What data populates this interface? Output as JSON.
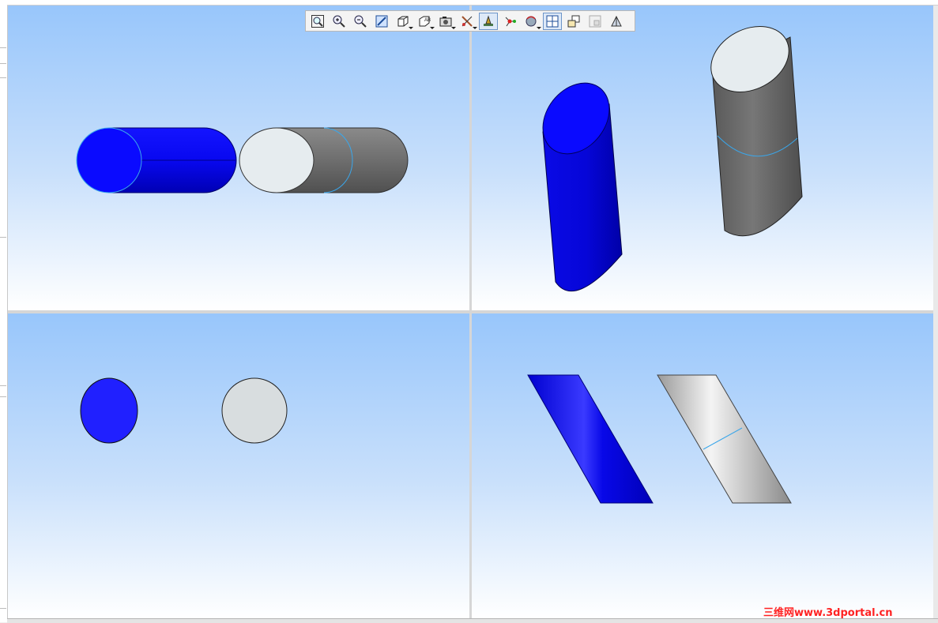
{
  "toolbar": {
    "buttons": [
      {
        "name": "zoom-to-fit",
        "tooltip": ""
      },
      {
        "name": "zoom-in",
        "tooltip": ""
      },
      {
        "name": "zoom-out",
        "tooltip": ""
      },
      {
        "name": "zoom-to-area",
        "tooltip": ""
      },
      {
        "name": "view-orientation",
        "tooltip": ""
      },
      {
        "name": "display-style",
        "tooltip": ""
      },
      {
        "name": "hide-show-items",
        "tooltip": ""
      },
      {
        "name": "appearance",
        "tooltip": ""
      },
      {
        "name": "scene-settings",
        "tooltip": ""
      },
      {
        "name": "view-settings",
        "tooltip": ""
      },
      {
        "name": "rotate-view",
        "tooltip": ""
      },
      {
        "name": "four-viewport",
        "tooltip": ""
      },
      {
        "name": "link-views",
        "tooltip": ""
      },
      {
        "name": "single-view",
        "tooltip": ""
      },
      {
        "name": "section-view",
        "tooltip": ""
      }
    ],
    "active_index": 11
  },
  "viewports": [
    {
      "name": "viewport-front",
      "bodies": [
        "blue-cylinder",
        "gray-cylinder"
      ]
    },
    {
      "name": "viewport-isometric",
      "bodies": [
        "blue-cylinder",
        "gray-cylinder"
      ]
    },
    {
      "name": "viewport-top",
      "bodies": [
        "blue-cylinder",
        "gray-cylinder"
      ]
    },
    {
      "name": "viewport-right",
      "bodies": [
        "blue-cylinder",
        "gray-cylinder"
      ]
    }
  ],
  "colors": {
    "body_blue": "#0a0aff",
    "body_gray": "#6b6b6b",
    "face_white": "#e6ecef",
    "edge_highlight": "#3aa6ea"
  },
  "watermark": {
    "text": "三维网www.3dportal.cn"
  }
}
